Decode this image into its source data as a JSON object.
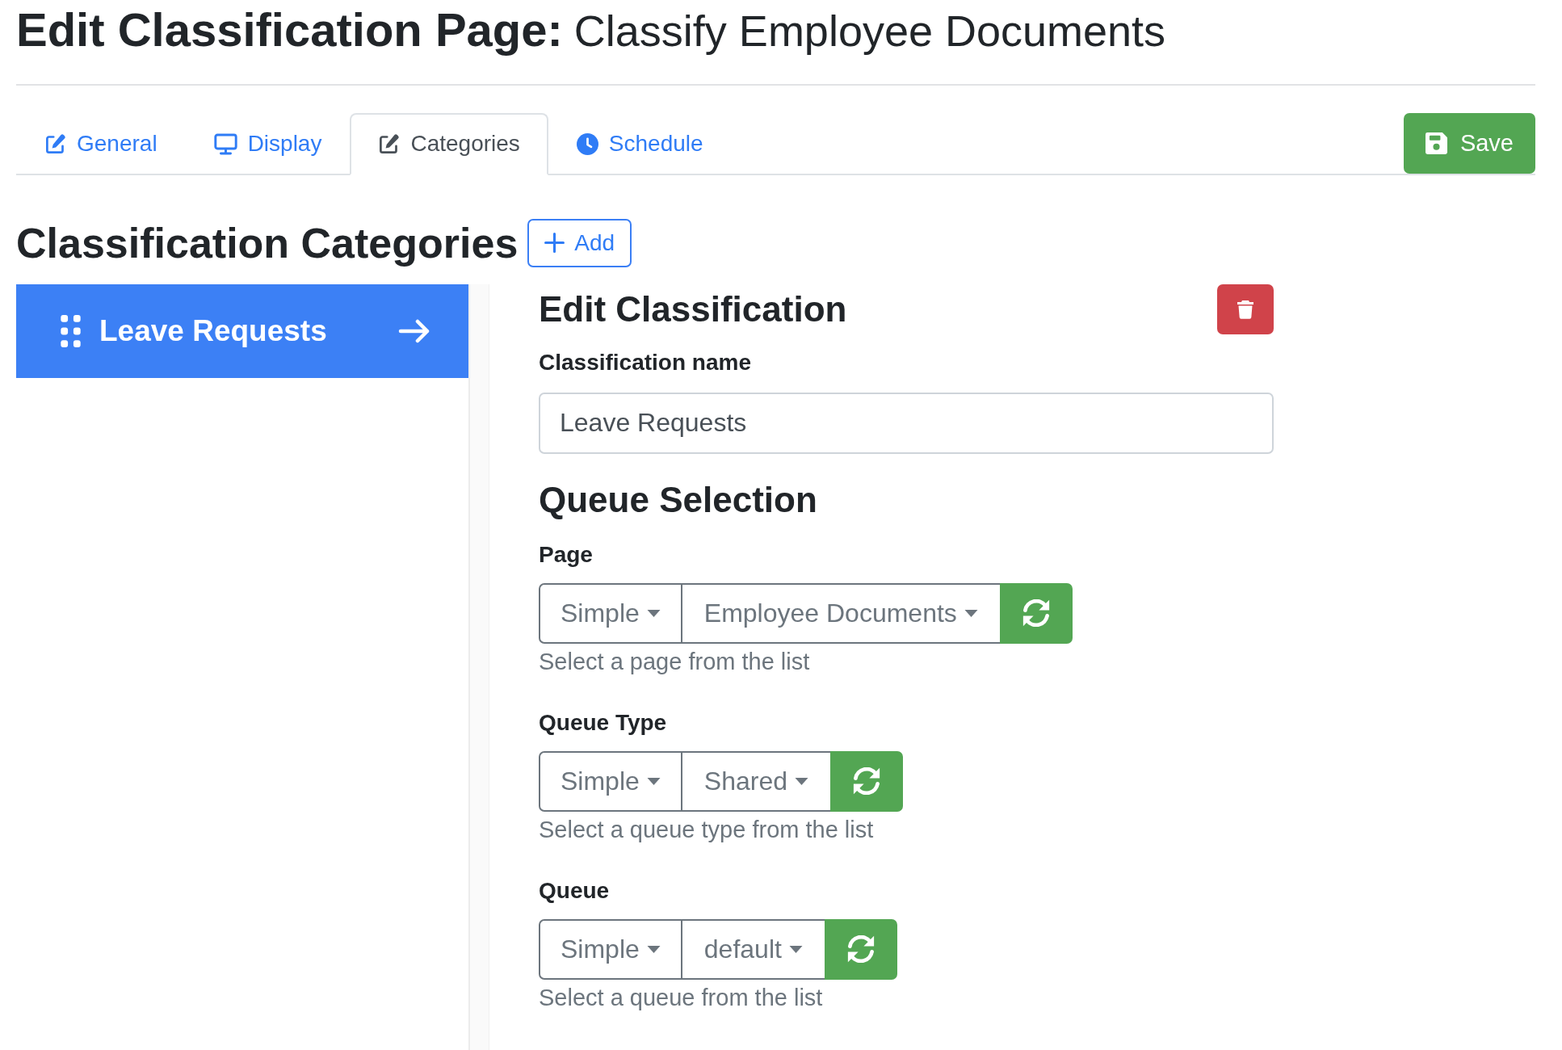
{
  "page_title": {
    "label": "Edit Classification Page:",
    "subject": "Classify Employee Documents"
  },
  "tabs": [
    {
      "label": "General",
      "selected": false
    },
    {
      "label": "Display",
      "selected": false
    },
    {
      "label": "Categories",
      "selected": true
    },
    {
      "label": "Schedule",
      "selected": false
    }
  ],
  "save_button": {
    "label": "Save"
  },
  "categories": {
    "title": "Classification Categories",
    "add_button": {
      "label": "Add"
    },
    "items": [
      {
        "label": "Leave Requests",
        "selected": true
      }
    ]
  },
  "edit_classification": {
    "title": "Edit Classification",
    "name_field": {
      "label": "Classification name",
      "value": "Leave Requests"
    }
  },
  "queue_selection": {
    "title": "Queue Selection",
    "fields": [
      {
        "label": "Page",
        "mode": "Simple",
        "value": "Employee Documents",
        "help": "Select a page from the list"
      },
      {
        "label": "Queue Type",
        "mode": "Simple",
        "value": "Shared",
        "help": "Select a queue type from the list"
      },
      {
        "label": "Queue",
        "mode": "Simple",
        "value": "default",
        "help": "Select a queue from the list"
      }
    ]
  }
}
